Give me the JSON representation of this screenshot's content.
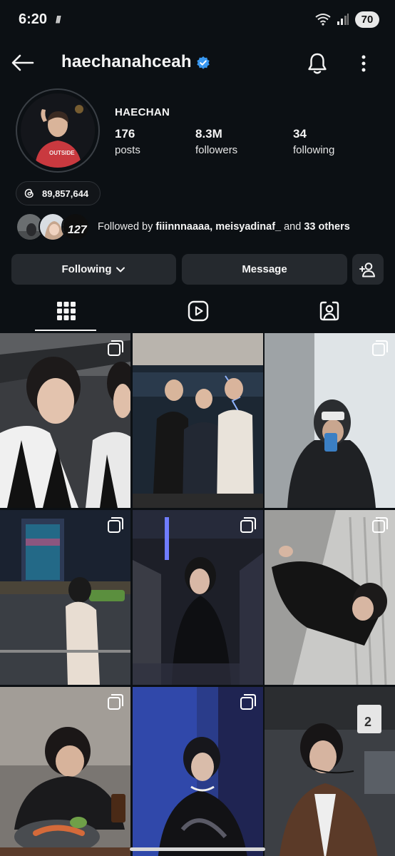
{
  "status_bar": {
    "time": "6:20",
    "left_glyph": "///",
    "battery": "70",
    "icons": [
      "wifi-icon",
      "signal-icon"
    ]
  },
  "header": {
    "username": "haechanahceah",
    "verified": true,
    "icons": [
      "back-arrow-icon",
      "verified-badge-icon",
      "bell-icon",
      "more-vertical-icon"
    ]
  },
  "profile": {
    "display_name": "HAECHAN",
    "stats": [
      {
        "value": "176",
        "label": "posts"
      },
      {
        "value": "8.3M",
        "label": "followers"
      },
      {
        "value": "34",
        "label": "following"
      }
    ],
    "threads_count": "89,857,644"
  },
  "followed_by": {
    "prefix": "Followed by ",
    "names": "fiiinnnaaaa, meisyadinaf_",
    "middle": " and ",
    "others": "33 others"
  },
  "actions": {
    "following_label": "Following",
    "message_label": "Message"
  },
  "tabs": [
    "posts-grid-icon",
    "reels-icon",
    "tagged-icon"
  ],
  "colors": {
    "background": "#0c1014",
    "button": "#25292e",
    "verified": "#3897f0",
    "text": "#f5f5f5"
  },
  "grid": [
    {
      "name": "post-stage-performance",
      "multi": true
    },
    {
      "name": "post-group-photo",
      "multi": false
    },
    {
      "name": "post-mirror-selfie",
      "multi": true
    },
    {
      "name": "post-city-night",
      "multi": true
    },
    {
      "name": "post-tunnel-leather",
      "multi": true
    },
    {
      "name": "post-lying-leather",
      "multi": true
    },
    {
      "name": "post-dinner",
      "multi": true
    },
    {
      "name": "post-blue-light",
      "multi": true
    },
    {
      "name": "post-brown-jacket",
      "multi": false
    }
  ]
}
